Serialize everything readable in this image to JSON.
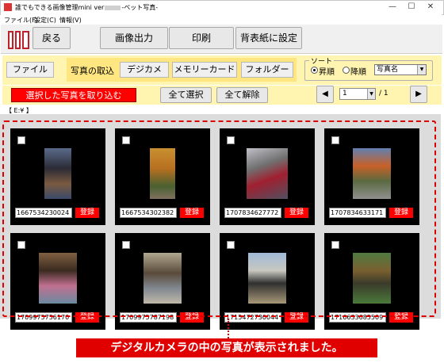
{
  "window": {
    "title_prefix": "誰でもできる画像管理mini ver",
    "title_suffix": "-ペット写真-",
    "controls": [
      "—",
      "☐",
      "✕"
    ]
  },
  "menu": [
    "ファイル(F)",
    "設定(C)",
    "情報(V)"
  ],
  "toolbar": {
    "back": "戻る",
    "export": "画像出力",
    "print": "印刷",
    "wallpaper": "背表紙に設定"
  },
  "import_bar": {
    "file": "ファイル",
    "import_label": "写真の取込",
    "camera": "デジカメ",
    "memory_card": "メモリーカード",
    "folder": "フォルダー"
  },
  "sort": {
    "label": "ソート",
    "ascending": "昇順",
    "descending": "降順",
    "field": "写真名",
    "selected": "ascending"
  },
  "action_bar": {
    "import_selected": "選択した写真を取り込む",
    "select_all": "全て選択",
    "clear_all": "全て解除",
    "page_current": "1",
    "page_total": "/ 1"
  },
  "path_label": "【 E:¥ 】",
  "photos": [
    {
      "id": "1667534230024",
      "register": "登録"
    },
    {
      "id": "1667534302382",
      "register": "登録"
    },
    {
      "id": "1707834627772",
      "register": "登録"
    },
    {
      "id": "1707834633171",
      "register": "登録"
    },
    {
      "id": "1709975756170",
      "register": "登録"
    },
    {
      "id": "1709975787198",
      "register": "登録"
    },
    {
      "id": "1715472730044",
      "register": "登録"
    },
    {
      "id": "1716633685509",
      "register": "登録"
    }
  ],
  "caption": "デジタルカメラの中の写真が表示されました。"
}
